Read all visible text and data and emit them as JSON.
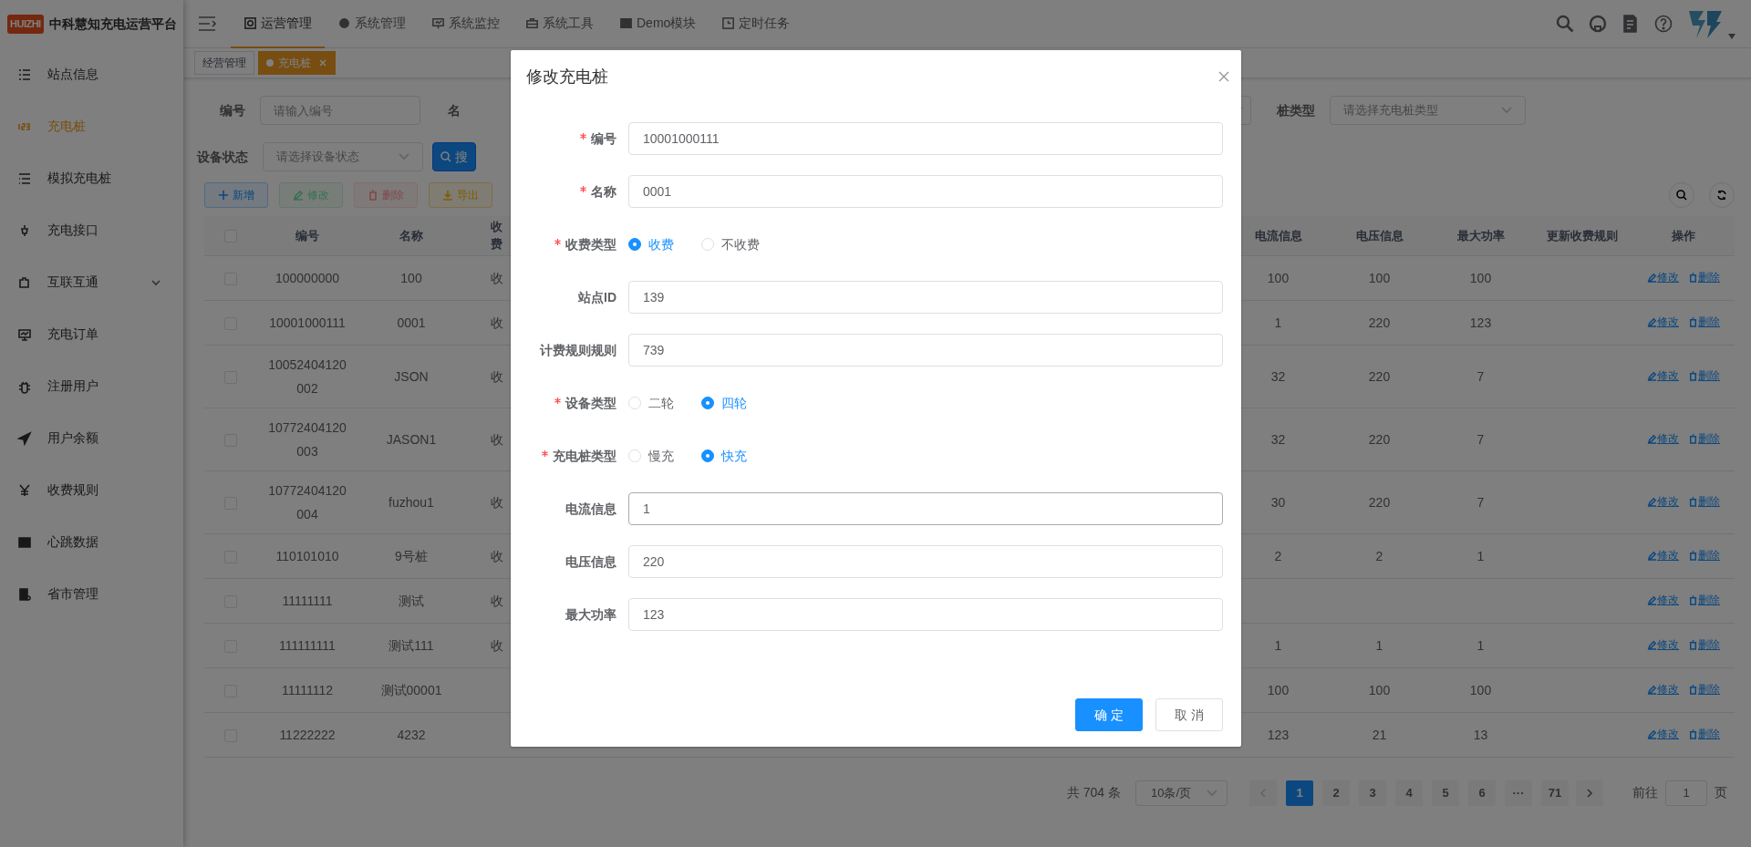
{
  "header": {
    "logo_badge": "HUIZHI",
    "app_title": "中科慧知充电运营平台",
    "top_menu": [
      {
        "label": "运营管理",
        "selected": true
      },
      {
        "label": "系统管理",
        "selected": false
      },
      {
        "label": "系统监控",
        "selected": false
      },
      {
        "label": "系统工具",
        "selected": false
      },
      {
        "label": "Demo模块",
        "selected": false
      },
      {
        "label": "定时任务",
        "selected": false
      }
    ]
  },
  "tags": [
    {
      "label": "经营管理",
      "selected": false,
      "closable": false
    },
    {
      "label": "充电桩",
      "selected": true,
      "closable": true
    }
  ],
  "sidebar": {
    "items": [
      {
        "label": "站点信息",
        "selected": false,
        "kind": "link"
      },
      {
        "label": "充电桩",
        "selected": true,
        "kind": "link"
      },
      {
        "label": "模拟充电桩",
        "selected": false,
        "kind": "link"
      },
      {
        "label": "充电接口",
        "selected": false,
        "kind": "link"
      },
      {
        "label": "互联互通",
        "selected": false,
        "kind": "group",
        "expanded": false
      },
      {
        "label": "充电订单",
        "selected": false,
        "kind": "link"
      },
      {
        "label": "注册用户",
        "selected": false,
        "kind": "link"
      },
      {
        "label": "用户余额",
        "selected": false,
        "kind": "link"
      },
      {
        "label": "收费规则",
        "selected": false,
        "kind": "link"
      },
      {
        "label": "心跳数据",
        "selected": false,
        "kind": "link"
      },
      {
        "label": "省市管理",
        "selected": false,
        "kind": "link"
      }
    ]
  },
  "filters": [
    {
      "kind": "input",
      "label": "编号",
      "placeholder": "请输入编号"
    },
    {
      "kind": "label",
      "label": "名"
    },
    {
      "kind": "select-cut"
    },
    {
      "kind": "select",
      "label": "桩类型",
      "placeholder": "请选择充电桩类型"
    },
    {
      "kind": "select",
      "label": "设备状态",
      "placeholder": "请选择设备状态"
    },
    {
      "kind": "search-button",
      "label": "搜"
    }
  ],
  "toolbar": [
    {
      "kind": "add",
      "label": "新增"
    },
    {
      "kind": "edit",
      "label": "修改"
    },
    {
      "kind": "delete",
      "label": "删除"
    },
    {
      "kind": "export",
      "label": "导出"
    }
  ],
  "table": {
    "select_all_checked": false,
    "columns": [
      "编号",
      "名称",
      "收费",
      "电流信息",
      "电压信息",
      "最大功率",
      "更新收费规则",
      "操作"
    ],
    "rows": [
      {
        "checked": false,
        "code": "100000000",
        "name": "100",
        "fee_type": "收",
        "current": "100",
        "voltage": "100",
        "max_power": "100",
        "actions": [
          "修改",
          "删除"
        ]
      },
      {
        "checked": false,
        "code": "10001000111",
        "name": "0001",
        "fee_type": "收",
        "current": "1",
        "voltage": "220",
        "max_power": "123",
        "actions": [
          "修改",
          "删除"
        ]
      },
      {
        "checked": false,
        "code": "10052404120002",
        "name": "JSON",
        "fee_type": "收",
        "current": "32",
        "voltage": "220",
        "max_power": "7",
        "actions": [
          "修改",
          "删除"
        ]
      },
      {
        "checked": false,
        "code": "10772404120003",
        "name": "JASON1",
        "fee_type": "收",
        "current": "32",
        "voltage": "220",
        "max_power": "7",
        "actions": [
          "修改",
          "删除"
        ]
      },
      {
        "checked": false,
        "code": "10772404120004",
        "name": "fuzhou1",
        "fee_type": "收",
        "current": "30",
        "voltage": "220",
        "max_power": "7",
        "actions": [
          "修改",
          "删除"
        ]
      },
      {
        "checked": false,
        "code": "110101010",
        "name": "9号桩",
        "fee_type": "收",
        "current": "2",
        "voltage": "2",
        "max_power": "1",
        "actions": [
          "修改",
          "删除"
        ]
      },
      {
        "checked": false,
        "code": "11111111",
        "name": "测试",
        "fee_type": "收",
        "actions": [
          "修改",
          "删除"
        ]
      },
      {
        "checked": false,
        "code": "111111111",
        "name": "测试111",
        "fee_type": "收",
        "current": "1",
        "voltage": "1",
        "max_power": "1",
        "actions": [
          "修改",
          "删除"
        ]
      },
      {
        "checked": false,
        "code": "11111112",
        "name": "测试00001",
        "current": "100",
        "voltage": "100",
        "max_power": "100",
        "actions": [
          "修改",
          "删除"
        ]
      },
      {
        "checked": false,
        "code": "11222222",
        "name": "4232",
        "current": "123",
        "voltage": "21",
        "max_power": "13",
        "actions": [
          "修改",
          "删除"
        ]
      }
    ]
  },
  "pagination": {
    "total": "共 704 条",
    "page_size": "10条/页",
    "pages": [
      {
        "label": "1",
        "selected": true
      },
      {
        "label": "2",
        "selected": false
      },
      {
        "label": "3",
        "selected": false
      },
      {
        "label": "4",
        "selected": false
      },
      {
        "label": "5",
        "selected": false
      },
      {
        "label": "6",
        "selected": false
      },
      {
        "label": "···",
        "selected": false
      },
      {
        "label": "71",
        "selected": false
      }
    ],
    "goto_label": "前往",
    "goto_value": "1",
    "page_suffix": "页"
  },
  "modal": {
    "title": "修改充电桩",
    "fields": [
      {
        "kind": "input",
        "label": "编号",
        "required": true,
        "value": "10001000111",
        "hovered": false
      },
      {
        "kind": "input",
        "label": "名称",
        "required": true,
        "value": "0001",
        "hovered": false
      },
      {
        "kind": "radio",
        "label": "收费类型",
        "required": true,
        "options": [
          {
            "label": "收费",
            "selected": true
          },
          {
            "label": "不收费",
            "selected": false
          }
        ]
      },
      {
        "kind": "input",
        "label": "站点ID",
        "required": false,
        "value": "139",
        "hovered": false
      },
      {
        "kind": "input",
        "label": "计费规则规则",
        "required": false,
        "value": "739",
        "hovered": false
      },
      {
        "kind": "radio",
        "label": "设备类型",
        "required": true,
        "options": [
          {
            "label": "二轮",
            "selected": false
          },
          {
            "label": "四轮",
            "selected": true
          }
        ]
      },
      {
        "kind": "radio",
        "label": "充电桩类型",
        "required": true,
        "options": [
          {
            "label": "慢充",
            "selected": false
          },
          {
            "label": "快充",
            "selected": true
          }
        ]
      },
      {
        "kind": "input",
        "label": "电流信息",
        "required": false,
        "value": "1",
        "hovered": true
      },
      {
        "kind": "input",
        "label": "电压信息",
        "required": false,
        "value": "220",
        "hovered": false
      },
      {
        "kind": "input",
        "label": "最大功率",
        "required": false,
        "value": "123",
        "hovered": false
      }
    ],
    "buttons": [
      {
        "kind": "primary",
        "label": "确 定"
      },
      {
        "kind": "default",
        "label": "取 消"
      }
    ]
  }
}
